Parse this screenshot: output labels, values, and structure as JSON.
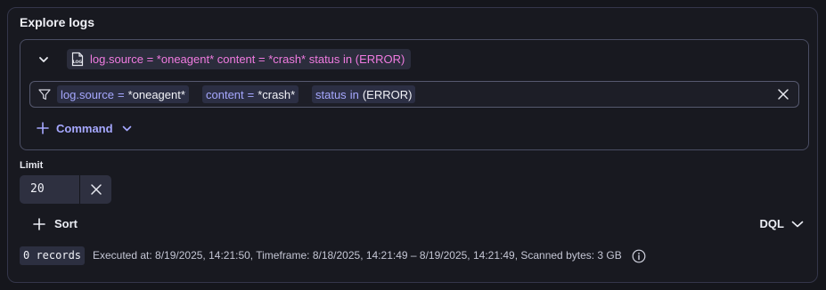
{
  "panel": {
    "title": "Explore logs"
  },
  "query": {
    "summary": "log.source = *oneagent* content = *crash* status in (ERROR)",
    "summary_icon": "log-file-icon",
    "collapse_icon": "chevron-down-icon",
    "filter_icon": "filter-icon",
    "clear_icon": "close-icon",
    "tokens": [
      {
        "key": "log.source",
        "op": "=",
        "value": "*oneagent*"
      },
      {
        "key": "content",
        "op": "=",
        "value": "*crash*"
      },
      {
        "key": "status",
        "op": "in",
        "value": "(ERROR)"
      }
    ],
    "add_command_label": "Command"
  },
  "limit": {
    "label": "Limit",
    "value": "20"
  },
  "sort": {
    "label": "Sort"
  },
  "mode": {
    "label": "DQL"
  },
  "status": {
    "records": "0 records",
    "executed": "Executed at: 8/19/2025, 14:21:50, Timeframe: 8/18/2025, 14:21:49 – 8/19/2025, 14:21:49, Scanned bytes: 3 GB"
  },
  "colors": {
    "accent": "#a6a8ff",
    "summary_text": "#f07be0",
    "background": "#15161c"
  }
}
